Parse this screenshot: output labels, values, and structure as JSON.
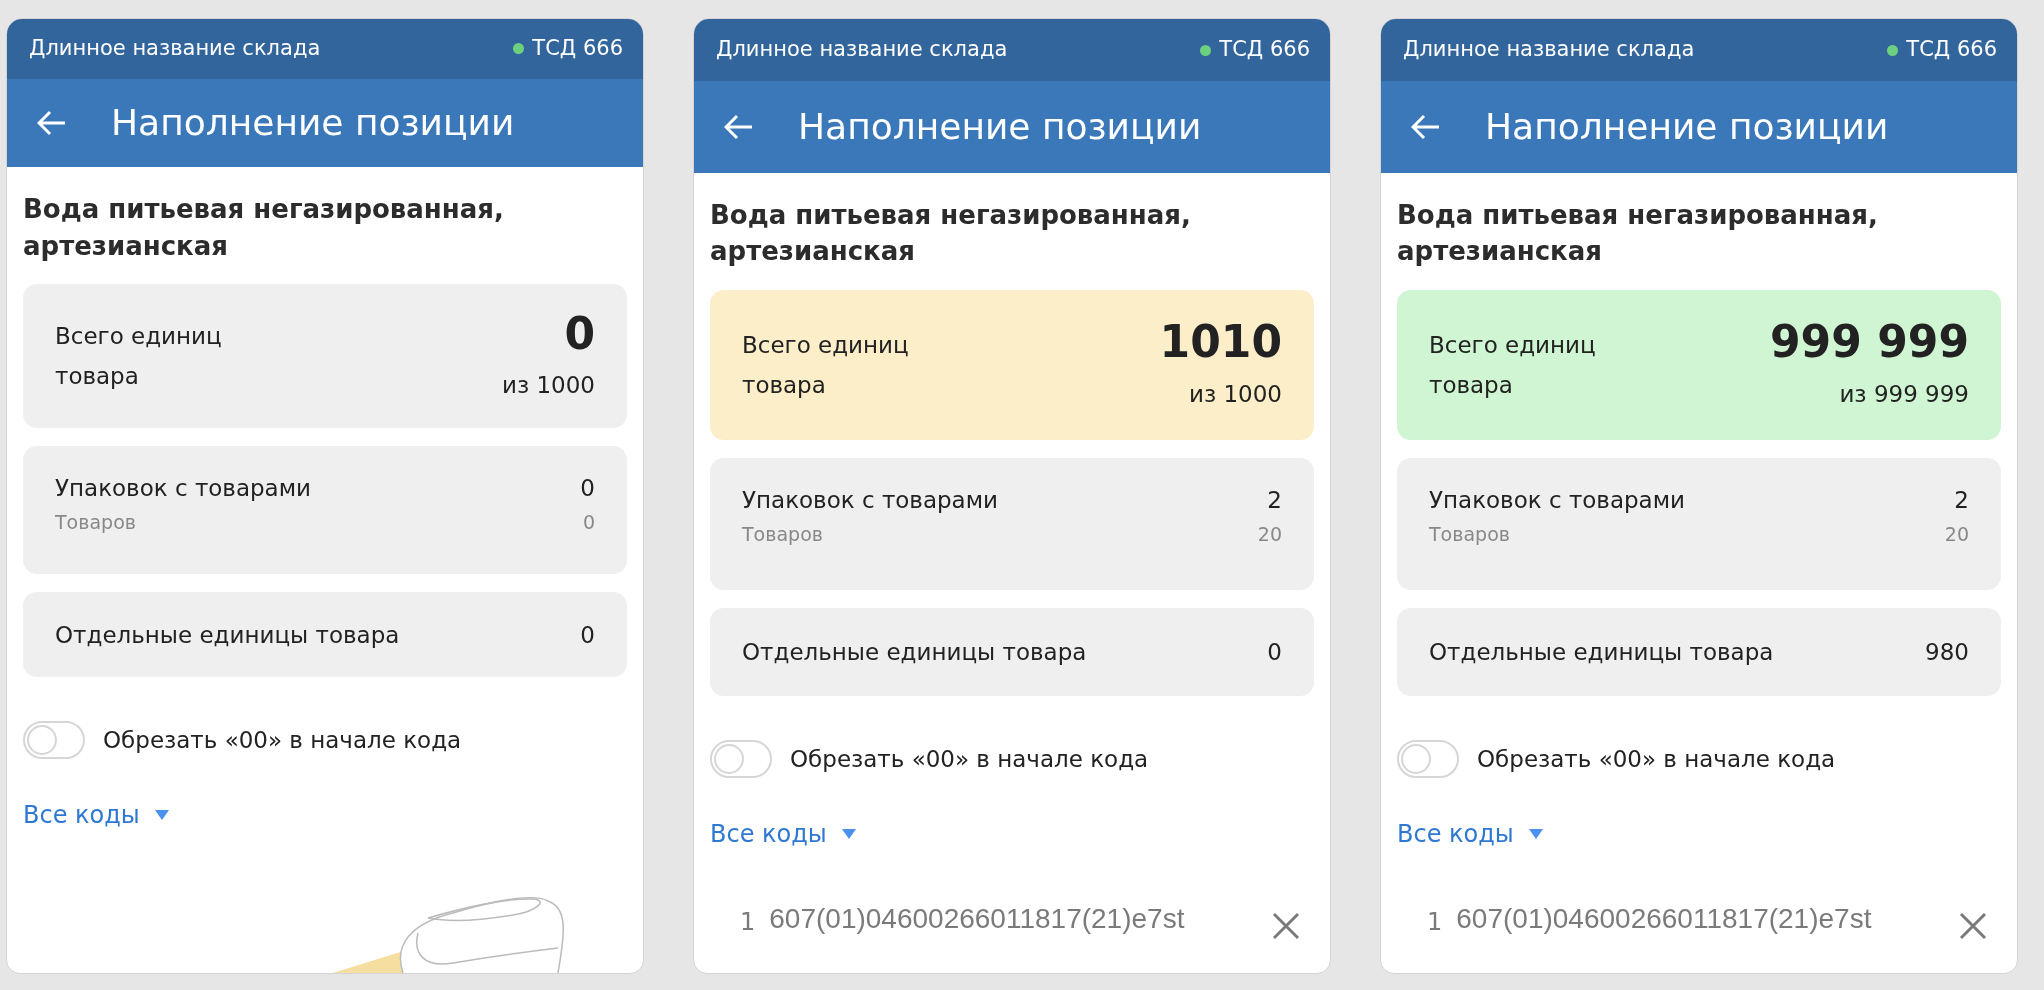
{
  "screens": [
    {
      "status_bar": {
        "warehouse": "Длинное название склада",
        "device": "ТСД 666",
        "color": "#6cd07f"
      },
      "title": "Наполнение позиции",
      "product": "Вода питьевая негазированная, артезианская",
      "total": {
        "kind": "neutral",
        "label": "Всего единиц товара",
        "value": "0",
        "of": "из 1000"
      },
      "packs": {
        "label": "Упаковок с товарами",
        "value": "0",
        "sub_label": "Товаров",
        "sub_value": "0"
      },
      "singles": {
        "label": "Отдельные единицы товара",
        "value": "0"
      },
      "trim_toggle": {
        "label": "Обрезать «00» в начале кода",
        "on": false
      },
      "all_codes": "Все коды"
    },
    {
      "status_bar": {
        "warehouse": "Длинное название склада",
        "device": "ТСД 666",
        "color": "#6cd07f"
      },
      "title": "Наполнение позиции",
      "product": "Вода питьевая негазированная, артезианская",
      "total": {
        "kind": "over",
        "label": "Всего единиц товара",
        "value": "1010",
        "of": "из 1000"
      },
      "packs": {
        "label": "Упаковок с товарами",
        "value": "2",
        "sub_label": "Товаров",
        "sub_value": "20"
      },
      "singles": {
        "label": "Отдельные единицы товара",
        "value": "0"
      },
      "trim_toggle": {
        "label": "Обрезать «00» в начале кода",
        "on": false
      },
      "all_codes": "Все коды",
      "codes": [
        {
          "index": "1",
          "code": "607(01)04600266011817(21)e7st"
        }
      ]
    },
    {
      "status_bar": {
        "warehouse": "Длинное название склада",
        "device": "ТСД 666",
        "color": "#6cd07f"
      },
      "title": "Наполнение позиции",
      "product": "Вода питьевая негазированная, артезианская",
      "total": {
        "kind": "complete",
        "label": "Всего единиц товара",
        "value": "999 999",
        "of": "из 999 999"
      },
      "packs": {
        "label": "Упаковок с товарами",
        "value": "2",
        "sub_label": "Товаров",
        "sub_value": "20"
      },
      "singles": {
        "label": "Отдельные единицы товара",
        "value": "980"
      },
      "trim_toggle": {
        "label": "Обрезать «00» в начале кода",
        "on": false
      },
      "all_codes": "Все коды",
      "codes": [
        {
          "index": "1",
          "code": "607(01)04600266011817(21)e7st"
        }
      ]
    }
  ]
}
